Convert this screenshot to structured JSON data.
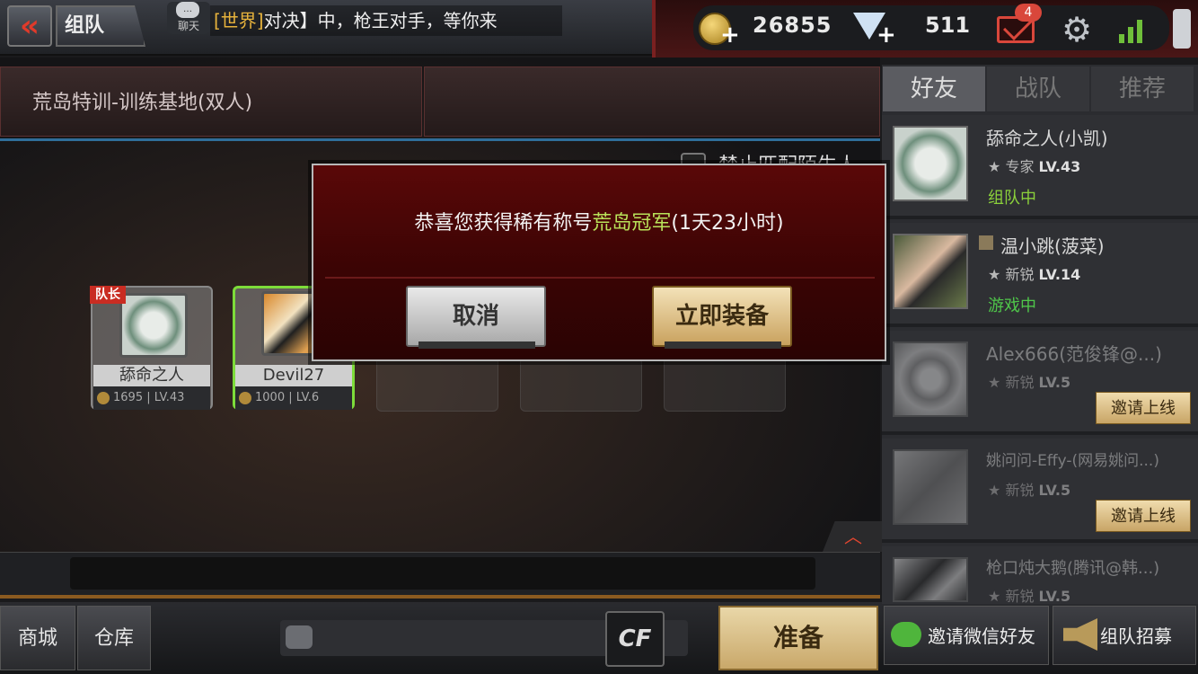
{
  "header": {
    "back_icon": "double-chevron-left",
    "title": "组队",
    "chat_label": "聊天",
    "world_channel": "[世界]",
    "world_message": "对决】中，枪王对手，等你来",
    "coins": "26855",
    "diamonds": "511",
    "mail_count": "4"
  },
  "room": {
    "map_name": "荒岛特训-训练基地(双人)",
    "block_strangers_label": "禁止匹配陌生人"
  },
  "slots": [
    {
      "leader_tag": "队长",
      "name": "舔命之人",
      "stats": "1695 | LV.43"
    },
    {
      "name": "Devil27",
      "stats": "1000 | LV.6"
    }
  ],
  "dialog": {
    "message_prefix": "恭喜您获得稀有称号",
    "title_highlight": "荒岛冠军",
    "message_suffix": "(1天23小时)",
    "cancel_label": "取消",
    "equip_label": "立即装备"
  },
  "friends_panel": {
    "tabs": [
      "好友",
      "战队",
      "推荐"
    ],
    "friends": [
      {
        "name": "舔命之人(小凯)",
        "rank": "专家",
        "level": "LV.43",
        "status": "组队中",
        "status_color": "#8bd13b"
      },
      {
        "name": "温小跳(菠菜)",
        "rank": "新锐",
        "level": "LV.14",
        "status": "游戏中",
        "status_color": "#4fc64a"
      },
      {
        "name": "Alex666(范俊锋@...)",
        "rank": "新锐",
        "level": "LV.5",
        "invite_label": "邀请上线"
      },
      {
        "name": "姚问问-Effy-(网易姚问...)",
        "rank": "新锐",
        "level": "LV.5",
        "invite_label": "邀请上线"
      },
      {
        "name": "枪口炖大鹅(腾讯@韩...)",
        "rank": "新锐",
        "level": "LV.5"
      }
    ]
  },
  "bottom": {
    "shop_label": "商城",
    "warehouse_label": "仓库",
    "logo_text": "CF",
    "ready_label": "准备",
    "wechat_invite_label": "邀请微信好友",
    "recruit_label": "组队招募"
  },
  "colors": {
    "accent_red": "#c92c22",
    "gold": "#c9a25e",
    "highlight_green": "#b9e35a"
  }
}
